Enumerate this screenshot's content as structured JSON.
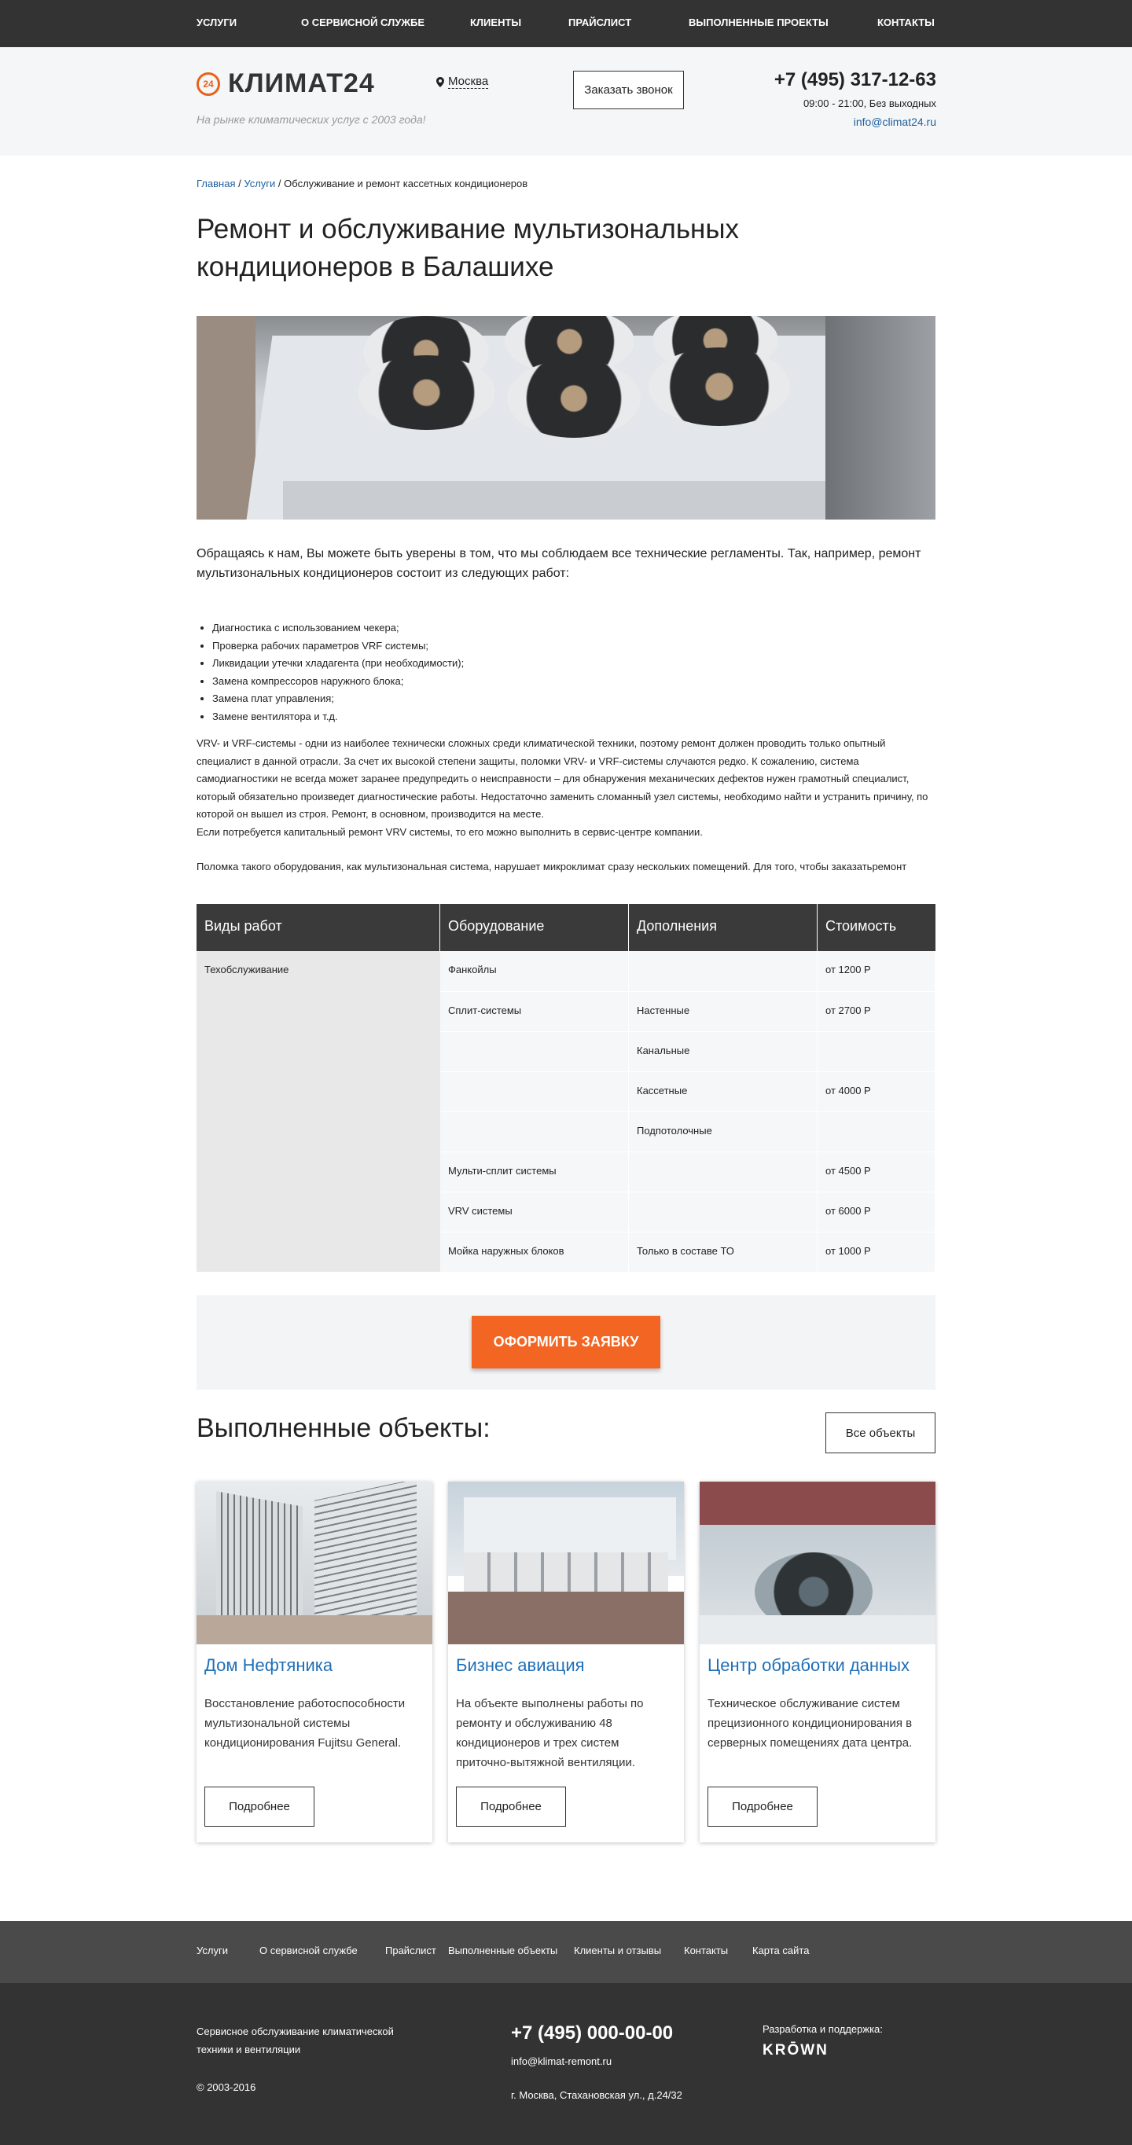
{
  "topnav": [
    "УСЛУГИ",
    "О СЕРВИСНОЙ СЛУЖБЕ",
    "КЛИЕНТЫ",
    "ПРАЙСЛИСТ",
    "ВЫПОЛНЕННЫЕ ПРОЕКТЫ",
    "КОНТАКТЫ"
  ],
  "header": {
    "logo_mark": "24",
    "logo_text": "КЛИМАТ24",
    "slogan": "На рынке климатических услуг с 2003 года!",
    "city": "Москва",
    "callback": "Заказать звонок",
    "phone": "+7 (495) 317-12-63",
    "hours": "09:00 - 21:00, Без выходных",
    "email": "info@climat24.ru"
  },
  "breadcrumb": {
    "home": "Главная",
    "sep1": " / ",
    "services": "Услуги",
    "sep2": " / ",
    "current": "Обслуживание и ремонт кассетных кондиционеров"
  },
  "page_title": "Ремонт и обслуживание мультизональных кондиционеров в Балашихе",
  "intro": "Обращаясь к нам, Вы можете быть уверены в том, что мы соблюдаем все технические регламенты. Так, например, ремонт мультизональных кондиционеров состоит из следующих работ:",
  "works": [
    "Диагностика с использованием чекера;",
    "Проверка рабочих параметров VRF системы;",
    "Ликвидации утечки хладагента (при необходимости);",
    "Замена компрессоров наружного блока;",
    "Замена плат управления;",
    "Замене вентилятора и т.д."
  ],
  "paragraph1": "VRV- и VRF-системы - одни из наиболее технически сложных среди климатической техники, поэтому ремонт должен проводить только опытный специалист в данной отрасли. За счет их высокой степени защиты, поломки VRV- и VRF-системы случаются редко. К сожалению, система самодиагностики не всегда может заранее предупредить о неисправности – для обнаружения механических дефектов нужен грамотный специалист, который обязательно произведет диагностические работы. Недостаточно заменить сломанный узел системы, необходимо найти и устранить причину, по которой он вышел из строя. Ремонт, в основном, производится на месте.",
  "paragraph2": "Если потребуется капитальный ремонт VRV системы, то его можно выполнить в сервис-центре компании.",
  "paragraph3": "Поломка такого оборудования, как мультизональная система, нарушает микроклимат сразу нескольких помещений. Для того, чтобы заказатьремонт",
  "table": {
    "headers": [
      "Виды работ",
      "Оборудование",
      "Дополнения",
      "Стоимость"
    ],
    "category": "Техобслуживание",
    "rows": [
      {
        "equipment": "Фанкойлы",
        "addition": "",
        "price": "от 1200 Р"
      },
      {
        "equipment": "Сплит-системы",
        "addition": "Настенные",
        "price": "от 2700 Р"
      },
      {
        "equipment": "",
        "addition": "Канальные",
        "price": ""
      },
      {
        "equipment": "",
        "addition": "Кассетные",
        "price": "от 4000 Р"
      },
      {
        "equipment": "",
        "addition": "Подпотолочные",
        "price": ""
      },
      {
        "equipment": "Мульти-сплит системы",
        "addition": "",
        "price": "от 4500 Р"
      },
      {
        "equipment": "VRV системы",
        "addition": "",
        "price": "от 6000 Р"
      },
      {
        "equipment": "Мойка наружных блоков",
        "addition": "Только в составе ТО",
        "price": "от 1000 Р"
      }
    ]
  },
  "order_button": "ОФОРМИТЬ ЗАЯВКУ",
  "objects": {
    "title": "Выполненные объекты:",
    "all_button": "Все объекты",
    "items": [
      {
        "title": "Дом Нефтяника",
        "text": "Восстановление работоспособности мультизональной системы кондиционирования Fujitsu General.",
        "more": "Подробнее"
      },
      {
        "title": "Бизнес авиация",
        "text": "На объекте выполнены работы по ремонту и обслуживанию 48 кондиционеров и трех систем приточно-вытяжной вентиляции.",
        "more": "Подробнее"
      },
      {
        "title": "Центр обработки данных",
        "text": "Техническое обслуживание систем прецизионного кондиционирования в серверных помещениях дата центра.",
        "more": "Подробнее"
      }
    ]
  },
  "footer_nav": [
    "Услуги",
    "О сервисной службе",
    "Прайслист",
    "Выполненные объекты",
    "Клиенты и отзывы",
    "Контакты",
    "Карта сайта"
  ],
  "footer": {
    "description": "Сервисное обслуживание климатической техники и вентиляции",
    "copyright": "© 2003-2016",
    "phone": "+7 (495) 000-00-00",
    "email": "info@klimat-remont.ru",
    "address": "г. Москва, Стахановская ул., д.24/32",
    "dev_label": "Разработка и поддержка:",
    "dev_name": "KRŌWN"
  },
  "colors": {
    "accent": "#f26522",
    "link": "#1f5f9e",
    "dark": "#333333"
  }
}
